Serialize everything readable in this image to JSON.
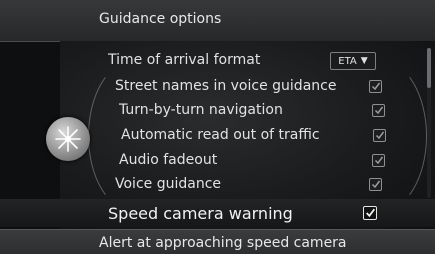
{
  "header": {
    "title": "Guidance options"
  },
  "menu": {
    "time_of_arrival": {
      "label": "Time of arrival format",
      "value": "ETA"
    },
    "items": [
      {
        "label": "Street names in voice guidance",
        "checked": true
      },
      {
        "label": "Turn-by-turn navigation",
        "checked": true
      },
      {
        "label": "Automatic read out of traffic",
        "checked": true
      },
      {
        "label": "Audio fadeout",
        "checked": true
      },
      {
        "label": "Voice guidance",
        "checked": true
      }
    ],
    "selected": {
      "label": "Speed camera warning",
      "checked": true
    }
  },
  "footer": {
    "description": "Alert at approaching speed camera"
  },
  "icons": {
    "joystick": "joystick-icon",
    "dropdown": "dropdown-arrow-icon",
    "check": "checkmark-icon"
  },
  "colors": {
    "background": "#0e0f10",
    "text": "#e2e2e2",
    "header": "#2f3133"
  }
}
